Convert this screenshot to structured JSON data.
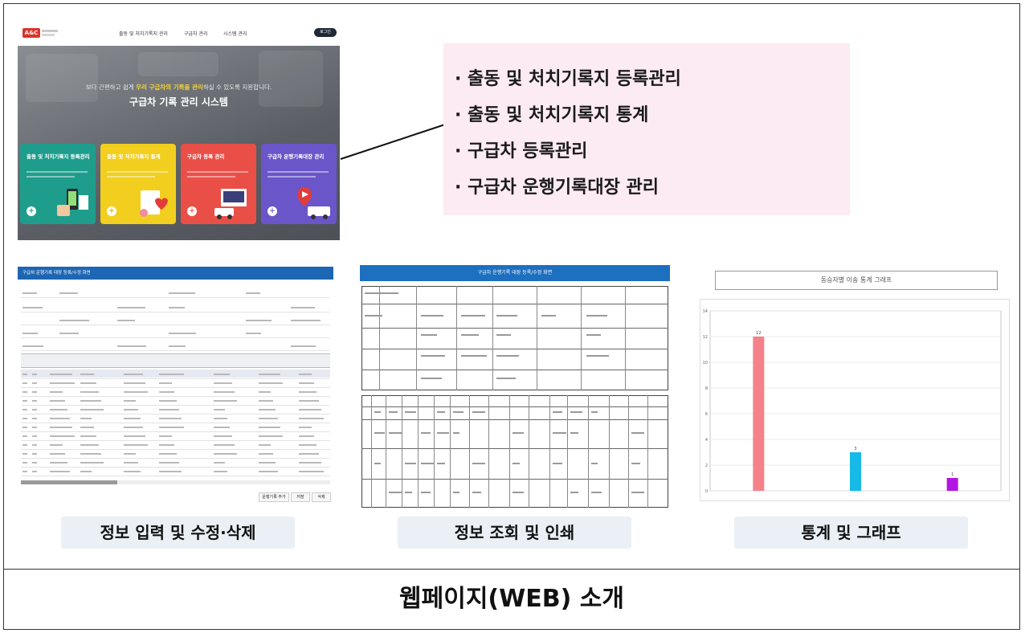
{
  "hero": {
    "logo_text": "A&C",
    "nav": [
      "출동 및 처치기록지 관리",
      "구급차 관리",
      "시스템 관리"
    ],
    "login_label": "로그인",
    "subtitle_pre": "보다 간편하고 쉽게 ",
    "subtitle_highlight": "우리 구급차의 기록을 관리",
    "subtitle_post": "하실 수 있도록 지원합니다.",
    "title": "구급차 기록 관리 시스템",
    "cards": [
      {
        "title": "출동 및 처치기록지 등록관리",
        "color": "#1f9d8c"
      },
      {
        "title": "출동 및 처치기록지 통계",
        "color": "#f2cf1f"
      },
      {
        "title": "구급차 등록 관리",
        "color": "#ea4f47"
      },
      {
        "title": "구급차 운행기록대장 관리",
        "color": "#6a56c9"
      }
    ]
  },
  "features": [
    "· 출동 및 처치기록지 등록관리",
    "· 출동 및 처치기록지 통계",
    "· 구급차 등록관리",
    "· 구급차 운행기록대장 관리"
  ],
  "screens": {
    "input": {
      "header": "구급차 운행기록 대장 등록/수정 화면",
      "buttons": [
        "운행기록 추가",
        "저장",
        "삭제"
      ]
    },
    "view": {
      "header": "구급차 운행기록 대장 등록/수정 화면"
    },
    "graph": {
      "title": "동승자별 이송 통계 그래프"
    }
  },
  "chart_data": {
    "type": "bar",
    "title": "동승자별 이송 통계 그래프",
    "categories": [
      "",
      "",
      ""
    ],
    "values": [
      12,
      3,
      1
    ],
    "colors": [
      "#f4828a",
      "#17b9e6",
      "#b317e3"
    ],
    "ylim": [
      0,
      14
    ],
    "yticks": [
      0,
      2,
      4,
      6,
      8,
      10,
      12,
      14
    ]
  },
  "labels": {
    "input": "정보 입력 및 수정·삭제",
    "view": "정보 조회 및 인쇄",
    "graph": "통계 및 그래프"
  },
  "caption": "웹페이지(WEB) 소개"
}
